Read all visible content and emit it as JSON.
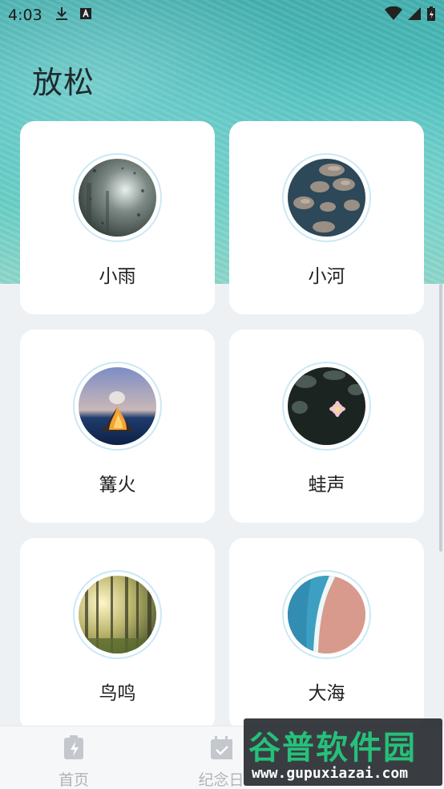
{
  "status_bar": {
    "time": "4:03",
    "icons": [
      "download-icon",
      "a-badge-icon",
      "wifi-icon",
      "signal-icon",
      "battery-charging-icon"
    ]
  },
  "header": {
    "title": "放松"
  },
  "sounds": [
    {
      "label": "小雨",
      "image": "rain-window-image"
    },
    {
      "label": "小河",
      "image": "river-stones-image"
    },
    {
      "label": "篝火",
      "image": "campfire-image"
    },
    {
      "label": "蛙声",
      "image": "lotus-pond-image"
    },
    {
      "label": "鸟鸣",
      "image": "forest-image"
    },
    {
      "label": "大海",
      "image": "beach-waves-image"
    }
  ],
  "bottom_nav": {
    "items": [
      {
        "label": "首页",
        "icon": "battery-bolt-icon"
      },
      {
        "label": "纪念日",
        "icon": "calendar-check-icon"
      }
    ]
  },
  "watermark": {
    "title": "谷普软件园",
    "url": "www.gupuxiazai.com"
  },
  "colors": {
    "accent_ring": "#cbe8f6",
    "hero": "#4cc2c0",
    "background": "#eef1f4"
  }
}
